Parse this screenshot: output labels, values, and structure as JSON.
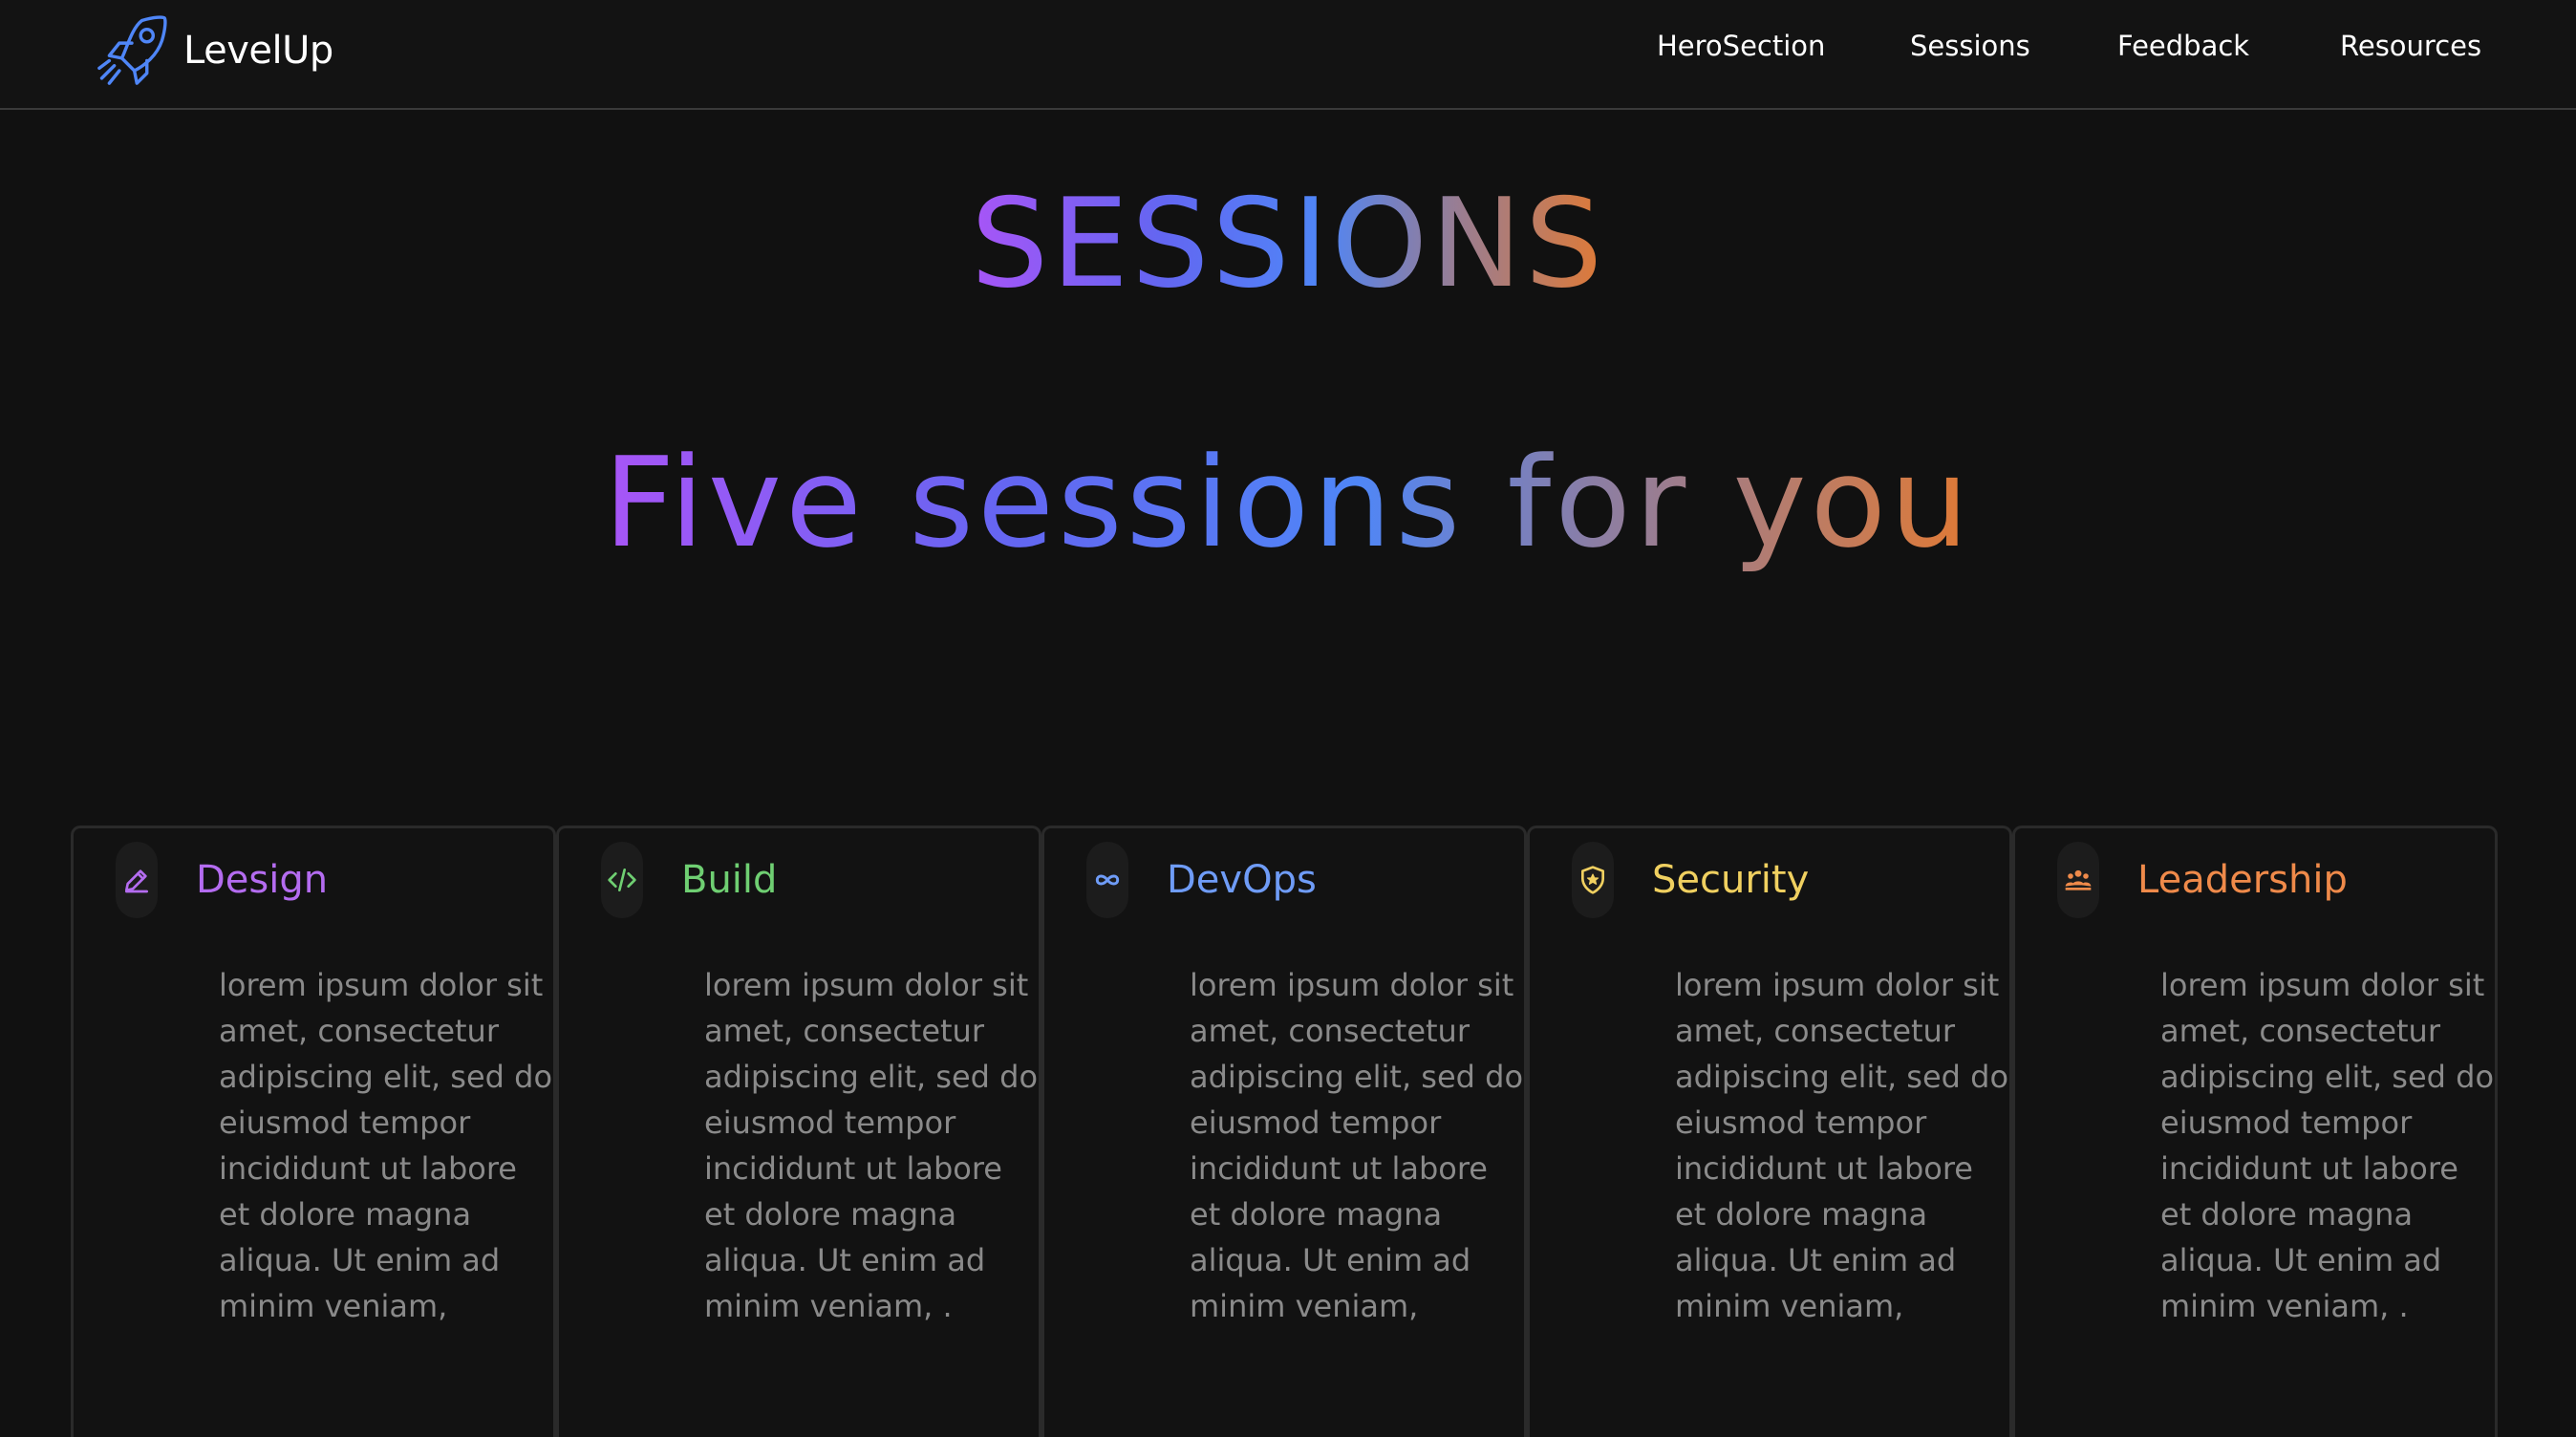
{
  "brand": {
    "name": "LevelUp",
    "icon": "rocket-icon",
    "color": "#4f86f7"
  },
  "nav": {
    "items": [
      {
        "label": "HeroSection"
      },
      {
        "label": "Sessions"
      },
      {
        "label": "Feedback"
      },
      {
        "label": "Resources"
      }
    ]
  },
  "sessions": {
    "title": "SESSIONS",
    "subtitle": "Five sessions for you",
    "cards": [
      {
        "title": "Design",
        "icon": "pencil-icon",
        "color": "#b46cf0",
        "body": "lorem ipsum dolor sit amet, consectetur adipiscing elit, sed do eiusmod tempor incididunt ut labore et dolore magna aliqua. Ut enim ad minim veniam,"
      },
      {
        "title": "Build",
        "icon": "code-icon",
        "color": "#6fcf72",
        "body": "lorem ipsum dolor sit amet, consectetur adipiscing elit, sed do eiusmod tempor incididunt ut labore et dolore magna aliqua. Ut enim ad minim veniam, ."
      },
      {
        "title": "DevOps",
        "icon": "infinity-icon",
        "color": "#6f9cf7",
        "body": "lorem ipsum dolor sit amet, consectetur adipiscing elit, sed do eiusmod tempor incididunt ut labore et dolore magna aliqua. Ut enim ad minim veniam,"
      },
      {
        "title": "Security",
        "icon": "shield-star-icon",
        "color": "#f0d060",
        "body": "lorem ipsum dolor sit amet, consectetur adipiscing elit, sed do eiusmod tempor incididunt ut labore et dolore magna aliqua. Ut enim ad minim veniam,"
      },
      {
        "title": "Leadership",
        "icon": "crowd-icon",
        "color": "#ef8a4a",
        "body": "lorem ipsum dolor sit amet, consectetur adipiscing elit, sed do eiusmod tempor incididunt ut labore et dolore magna aliqua. Ut enim ad minim veniam, ."
      }
    ]
  }
}
